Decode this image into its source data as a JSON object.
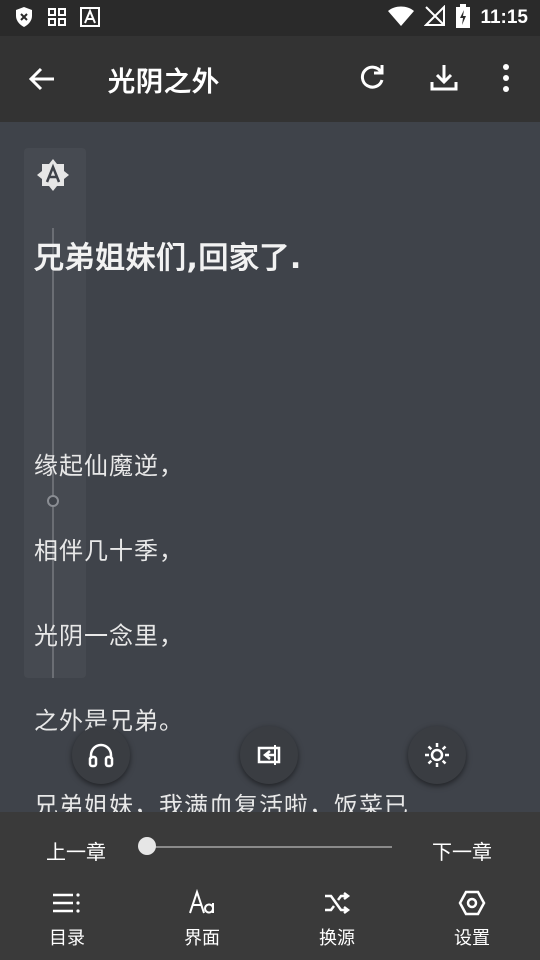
{
  "status_bar": {
    "time": "11:15",
    "left_icons": [
      "shield-x-icon",
      "grid-icon",
      "font-a-icon"
    ],
    "right_icons": [
      "wifi-icon",
      "no-signal-icon",
      "battery-charging-icon"
    ]
  },
  "toolbar": {
    "title": "光阴之外",
    "back_icon": "arrow-back-icon",
    "actions": [
      "refresh-icon",
      "download-icon",
      "more-vertical-icon"
    ]
  },
  "content": {
    "chapter_title": "兄弟姐妹们,回家了.",
    "lines": [
      "缘起仙魔逆，",
      "相伴几十季，",
      "光阴一念里，",
      "之外是兄弟。",
      "兄弟姐妹，我满血复活啦，饭菜已"
    ]
  },
  "floating_buttons": [
    "headphones-icon",
    "replace-icon",
    "brightness-icon"
  ],
  "chapter_nav": {
    "prev_label": "上一章",
    "next_label": "下一章",
    "progress_percent": 0
  },
  "bottom_nav": {
    "items": [
      {
        "label": "目录",
        "icon": "list-icon"
      },
      {
        "label": "界面",
        "icon": "font-style-icon"
      },
      {
        "label": "换源",
        "icon": "shuffle-icon"
      },
      {
        "label": "设置",
        "icon": "settings-hex-icon"
      }
    ]
  },
  "colors": {
    "reader_bg": "#3f434a",
    "toolbar_bg": "#333333",
    "text": "#e8e8e8"
  }
}
